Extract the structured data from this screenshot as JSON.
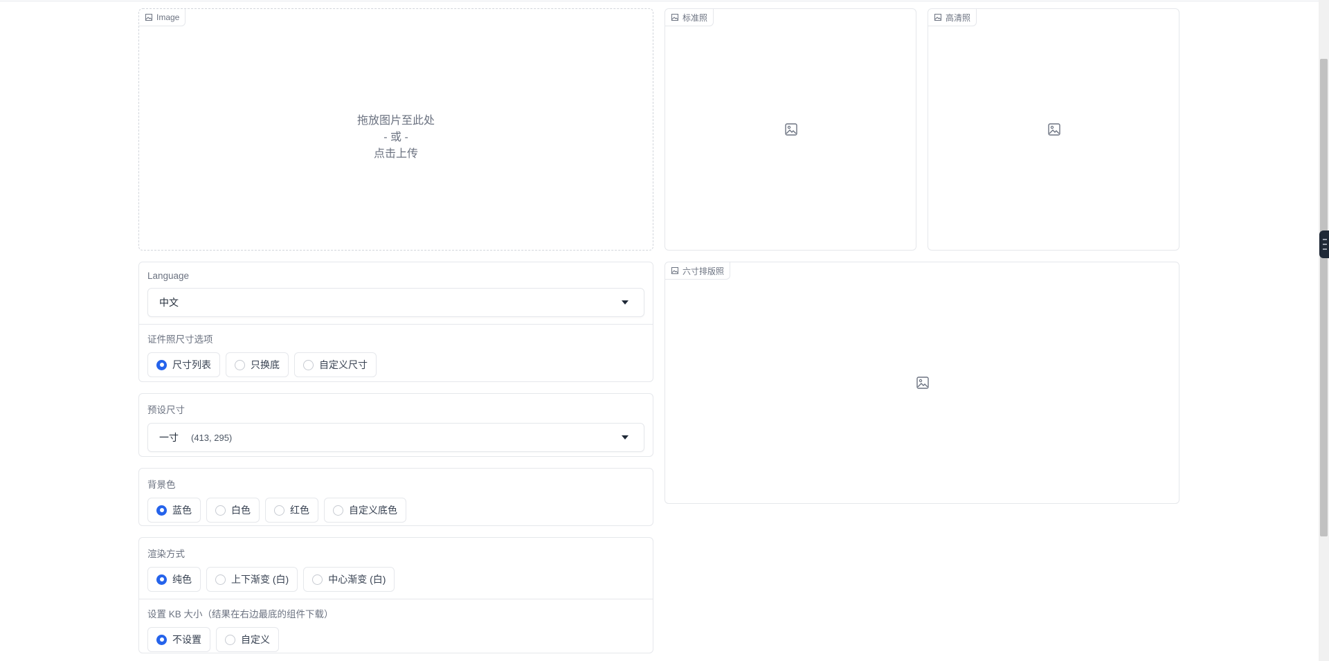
{
  "left": {
    "image_upload": {
      "tag_label": "Image",
      "drop_text": "拖放图片至此处",
      "or_text": "- 或 -",
      "click_text": "点击上传"
    },
    "language": {
      "label": "Language",
      "value": "中文"
    },
    "size_option": {
      "label": "证件照尺寸选项",
      "options": [
        "尺寸列表",
        "只换底",
        "自定义尺寸"
      ],
      "selected": "尺寸列表"
    },
    "preset_size": {
      "label": "预设尺寸",
      "value_name": "一寸",
      "value_dims": "(413, 295)"
    },
    "background_color": {
      "label": "背景色",
      "options": [
        "蓝色",
        "白色",
        "红色",
        "自定义底色"
      ],
      "selected": "蓝色"
    },
    "render_mode": {
      "label": "渲染方式",
      "options": [
        "纯色",
        "上下渐变 (白)",
        "中心渐变 (白)"
      ],
      "selected": "纯色"
    },
    "kb_size": {
      "label": "设置 KB 大小（结果在右边最底的组件下载）",
      "options": [
        "不设置",
        "自定义"
      ],
      "selected": "不设置"
    }
  },
  "right": {
    "standard_photo": {
      "tag_label": "标准照"
    },
    "hd_photo": {
      "tag_label": "高清照"
    },
    "layout_photo": {
      "tag_label": "六寸排版照"
    }
  },
  "icons": {
    "tag_icon": "image-icon",
    "placeholder_icon": "image-placeholder-icon",
    "select_caret": "caret-down-icon"
  },
  "colors": {
    "accent": "#2563eb",
    "border": "#e5e7eb",
    "text_muted": "#6b7280"
  }
}
